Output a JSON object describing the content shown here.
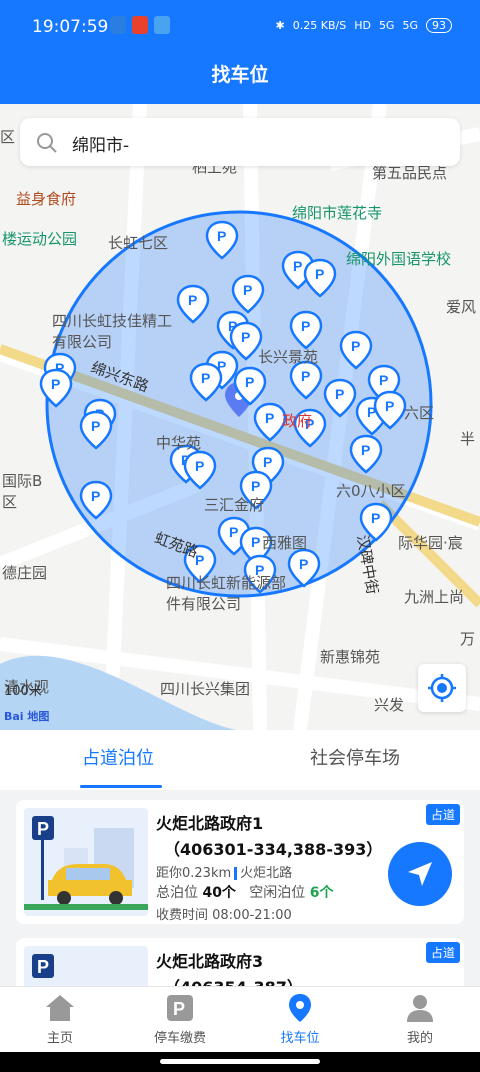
{
  "status": {
    "time": "19:07:59",
    "net_speed": "0.25 KB/S",
    "signal1": "5G",
    "signal2": "5G",
    "battery": "93"
  },
  "header": {
    "title": "找车位"
  },
  "search": {
    "value": "绵阳市-"
  },
  "map": {
    "labels": [
      "益身食府",
      "绵阳市莲花寺",
      "长虹七区",
      "第五品民点",
      "楼运动公园",
      "绵阳外国语学校",
      "四川长虹技佳精工有限公司",
      "长兴景苑",
      "爱风",
      "绵兴东路",
      "政府",
      "六区",
      "中华苑",
      "半",
      "国际B区",
      "六0八小区",
      "三汇金府",
      "虹苑路",
      "西雅图",
      "际华园·宸",
      "德庄园",
      "四川长虹新能源部件有限公司",
      "九洲上尚",
      "万",
      "新惠锦苑",
      "四川长兴集团",
      "兴发",
      "清水观",
      "区",
      "栖上苑",
      "汉碑中街"
    ],
    "scale": "100米",
    "logo": "Bai 地图"
  },
  "tabs": [
    "占道泊位",
    "社会停车场"
  ],
  "cards": [
    {
      "title": "火炬北路政府1",
      "code": "（406301-334,388-393）",
      "distance": "距你0.23km",
      "road": "火炬北路",
      "total_label": "总泊位",
      "total": "40个",
      "free_label": "空闲泊位",
      "free": "6个",
      "hours": "收费时间 08:00-21:00",
      "badge": "占道"
    },
    {
      "title": "火炬北路政府3",
      "code": "（406354-387）",
      "badge": "占道"
    }
  ],
  "nav": [
    "主页",
    "停车缴费",
    "找车位",
    "我的"
  ],
  "colors": {
    "primary": "#1677ff",
    "free": "#1aa34a"
  }
}
